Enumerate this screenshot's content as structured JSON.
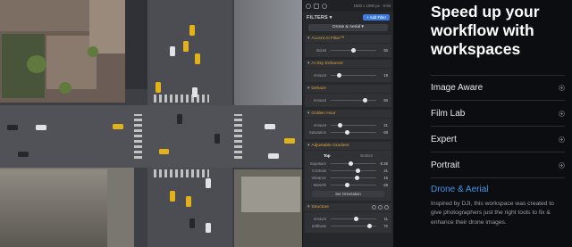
{
  "panel": {
    "dimensions": "1600 x 1080 px · 8-bit",
    "filters_label": "FILTERS ▾",
    "add_filter": "+ Add Filter",
    "workspace": "Drone & Aerial ▾",
    "sections": [
      {
        "title": "Accent AI Filter™",
        "sliders": [
          {
            "label": "Boost",
            "value": "50",
            "level": 0.5
          }
        ]
      },
      {
        "title": "AI Sky Enhancer",
        "sliders": [
          {
            "label": "Amount",
            "value": "19",
            "level": 0.19
          }
        ]
      },
      {
        "title": "Dehaze",
        "sliders": [
          {
            "label": "Amount",
            "value": "50",
            "level": 0.75
          }
        ]
      },
      {
        "title": "Golden Hour",
        "sliders": [
          {
            "label": "Amount",
            "value": "21",
            "level": 0.21
          },
          {
            "label": "Saturation",
            "value": "-28",
            "level": 0.36
          }
        ]
      },
      {
        "title": "Adjustable Gradient",
        "tabs": [
          "Top",
          "Bottom"
        ],
        "sliders": [
          {
            "label": "Exposure",
            "value": "-0.25",
            "level": 0.45
          },
          {
            "label": "Contrast",
            "value": "21",
            "level": 0.6
          },
          {
            "label": "Vibrance",
            "value": "15",
            "level": 0.57
          },
          {
            "label": "Warmth",
            "value": "-28",
            "level": 0.36
          }
        ],
        "button": "Set Orientation"
      },
      {
        "title": "Structure",
        "sliders": [
          {
            "label": "Amount",
            "value": "11",
            "level": 0.55
          },
          {
            "label": "Softness",
            "value": "72",
            "level": 0.86
          }
        ]
      }
    ]
  },
  "info": {
    "headline": "Speed up your workflow with workspaces",
    "workspaces": [
      "Image Aware",
      "Film Lab",
      "Expert",
      "Portrait"
    ],
    "active_title": "Drone & Aerial",
    "active_description": "Inspired by DJI, this workspace was created to give photographers just the right tools to fix & enhance their drone images."
  },
  "colors": {
    "accent_blue": "#3f97ee",
    "section_orange": "#e0a43a",
    "taxi_yellow": "#e3b118"
  }
}
